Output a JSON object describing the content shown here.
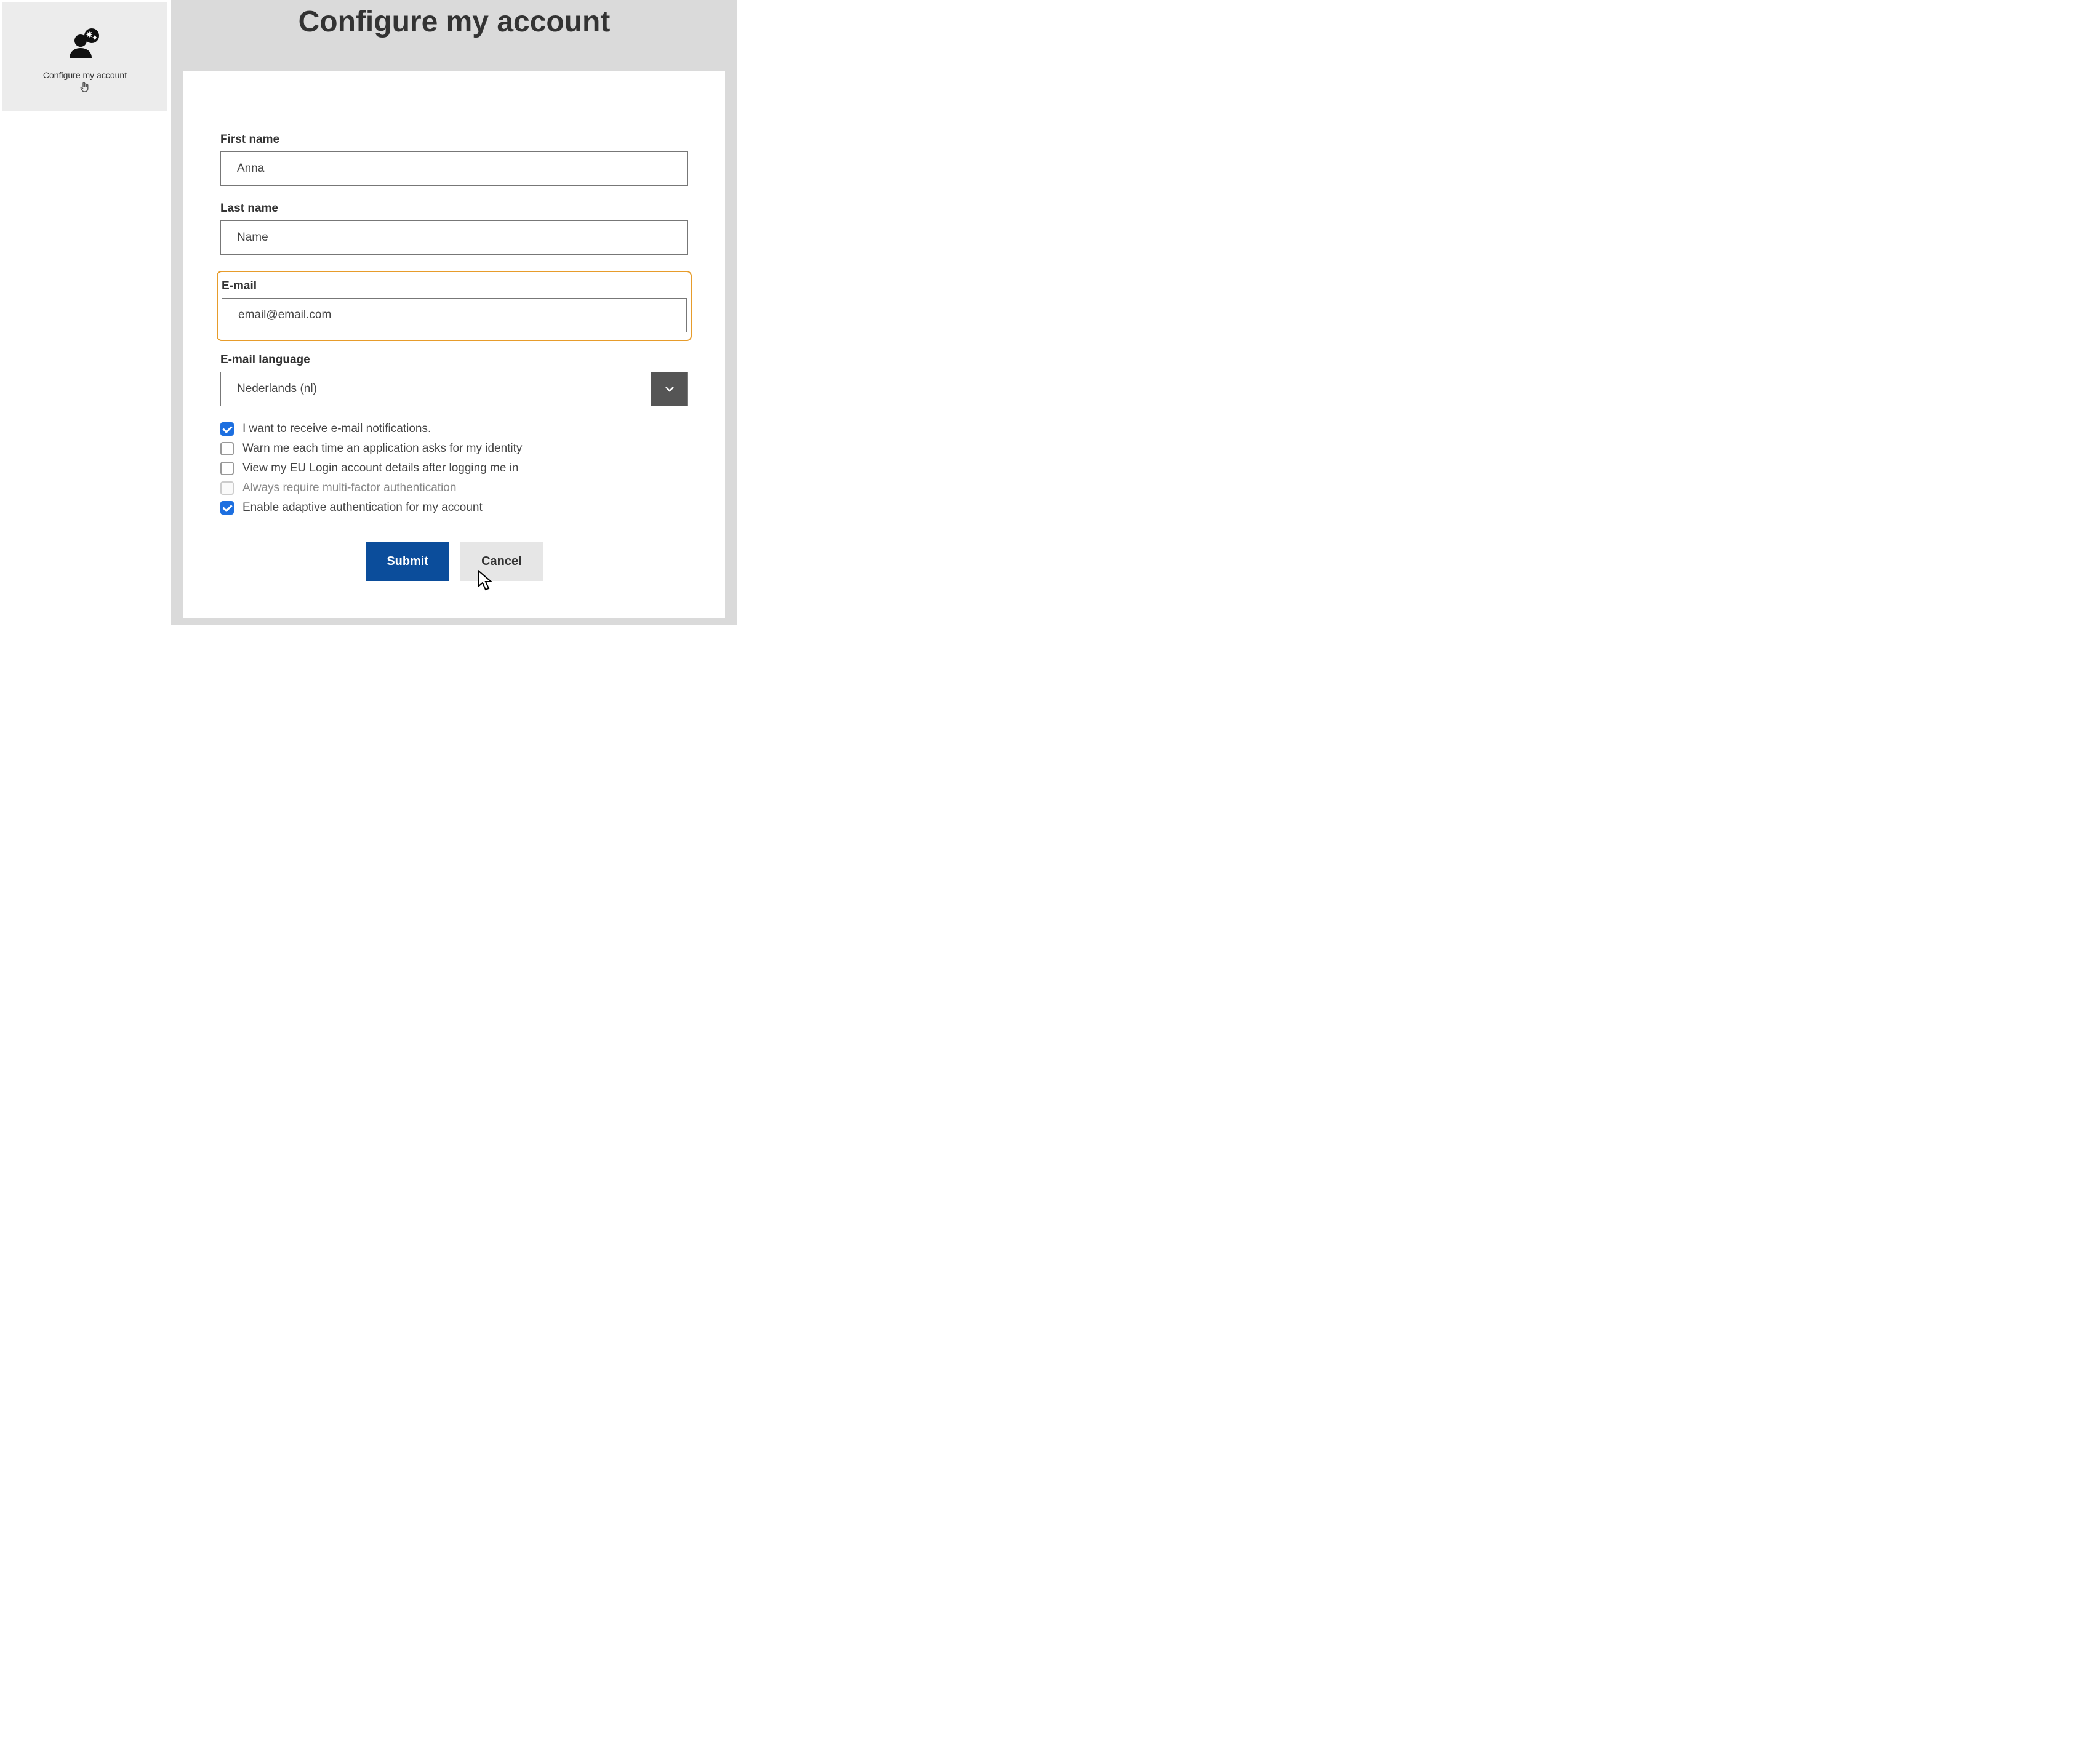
{
  "tile": {
    "label": "Configure my account"
  },
  "page": {
    "title": "Configure my account"
  },
  "form": {
    "first_name": {
      "label": "First name",
      "value": "Anna"
    },
    "last_name": {
      "label": "Last name",
      "value": "Name"
    },
    "email": {
      "label": "E-mail",
      "value": "email@email.com"
    },
    "email_language": {
      "label": "E-mail language",
      "selected": "Nederlands (nl)"
    },
    "checks": [
      {
        "label": "I want to receive e-mail notifications.",
        "checked": true,
        "disabled": false
      },
      {
        "label": "Warn me each time an application asks for my identity",
        "checked": false,
        "disabled": false
      },
      {
        "label": "View my EU Login account details after logging me in",
        "checked": false,
        "disabled": false
      },
      {
        "label": "Always require multi-factor authentication",
        "checked": false,
        "disabled": true
      },
      {
        "label": "Enable adaptive authentication for my account",
        "checked": true,
        "disabled": false
      }
    ],
    "buttons": {
      "submit": "Submit",
      "cancel": "Cancel"
    }
  }
}
